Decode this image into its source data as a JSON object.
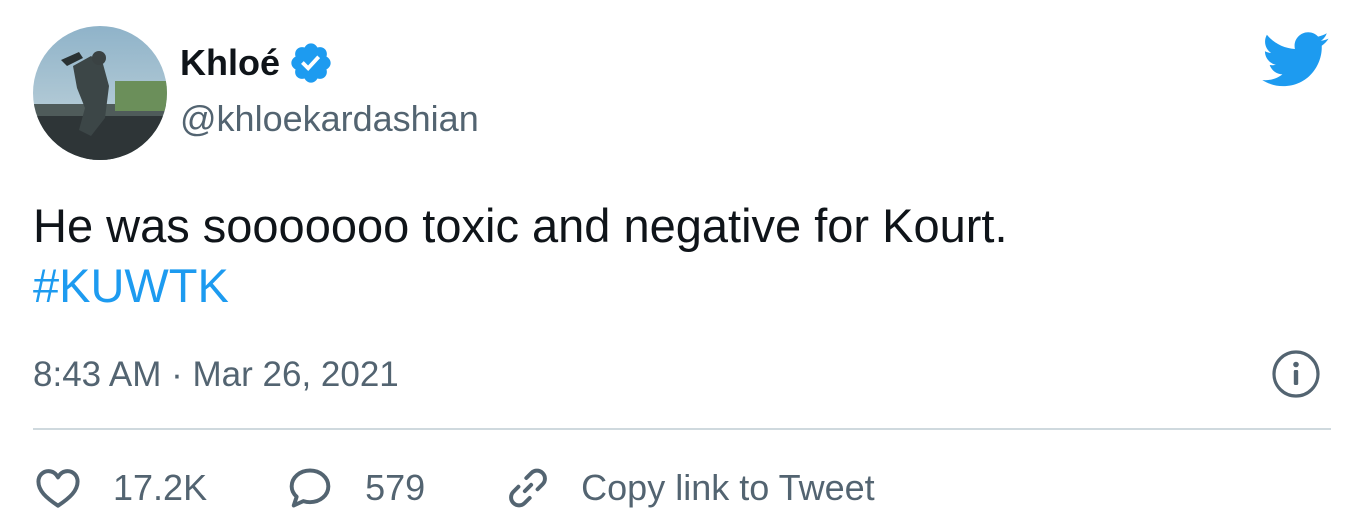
{
  "author": {
    "name": "Khloé",
    "handle": "@khloekardashian",
    "verified": true,
    "avatar_icon": "profile-photo"
  },
  "tweet": {
    "text": "He was sooooooo toxic and negative for Kourt.",
    "hashtag": "#KUWTK",
    "timestamp": "8:43 AM · Mar 26, 2021"
  },
  "actions": {
    "like_count": "17.2K",
    "reply_count": "579",
    "copy_link_label": "Copy link to Tweet"
  },
  "icons": {
    "brand": "twitter-bird-icon",
    "verified": "verified-badge-icon",
    "info": "info-icon",
    "like": "heart-icon",
    "reply": "speech-bubble-icon",
    "copy": "link-icon"
  },
  "colors": {
    "brand_blue": "#1d9bf0",
    "text_primary": "#0f1419",
    "text_secondary": "#536471",
    "divider": "#cfd9de"
  }
}
